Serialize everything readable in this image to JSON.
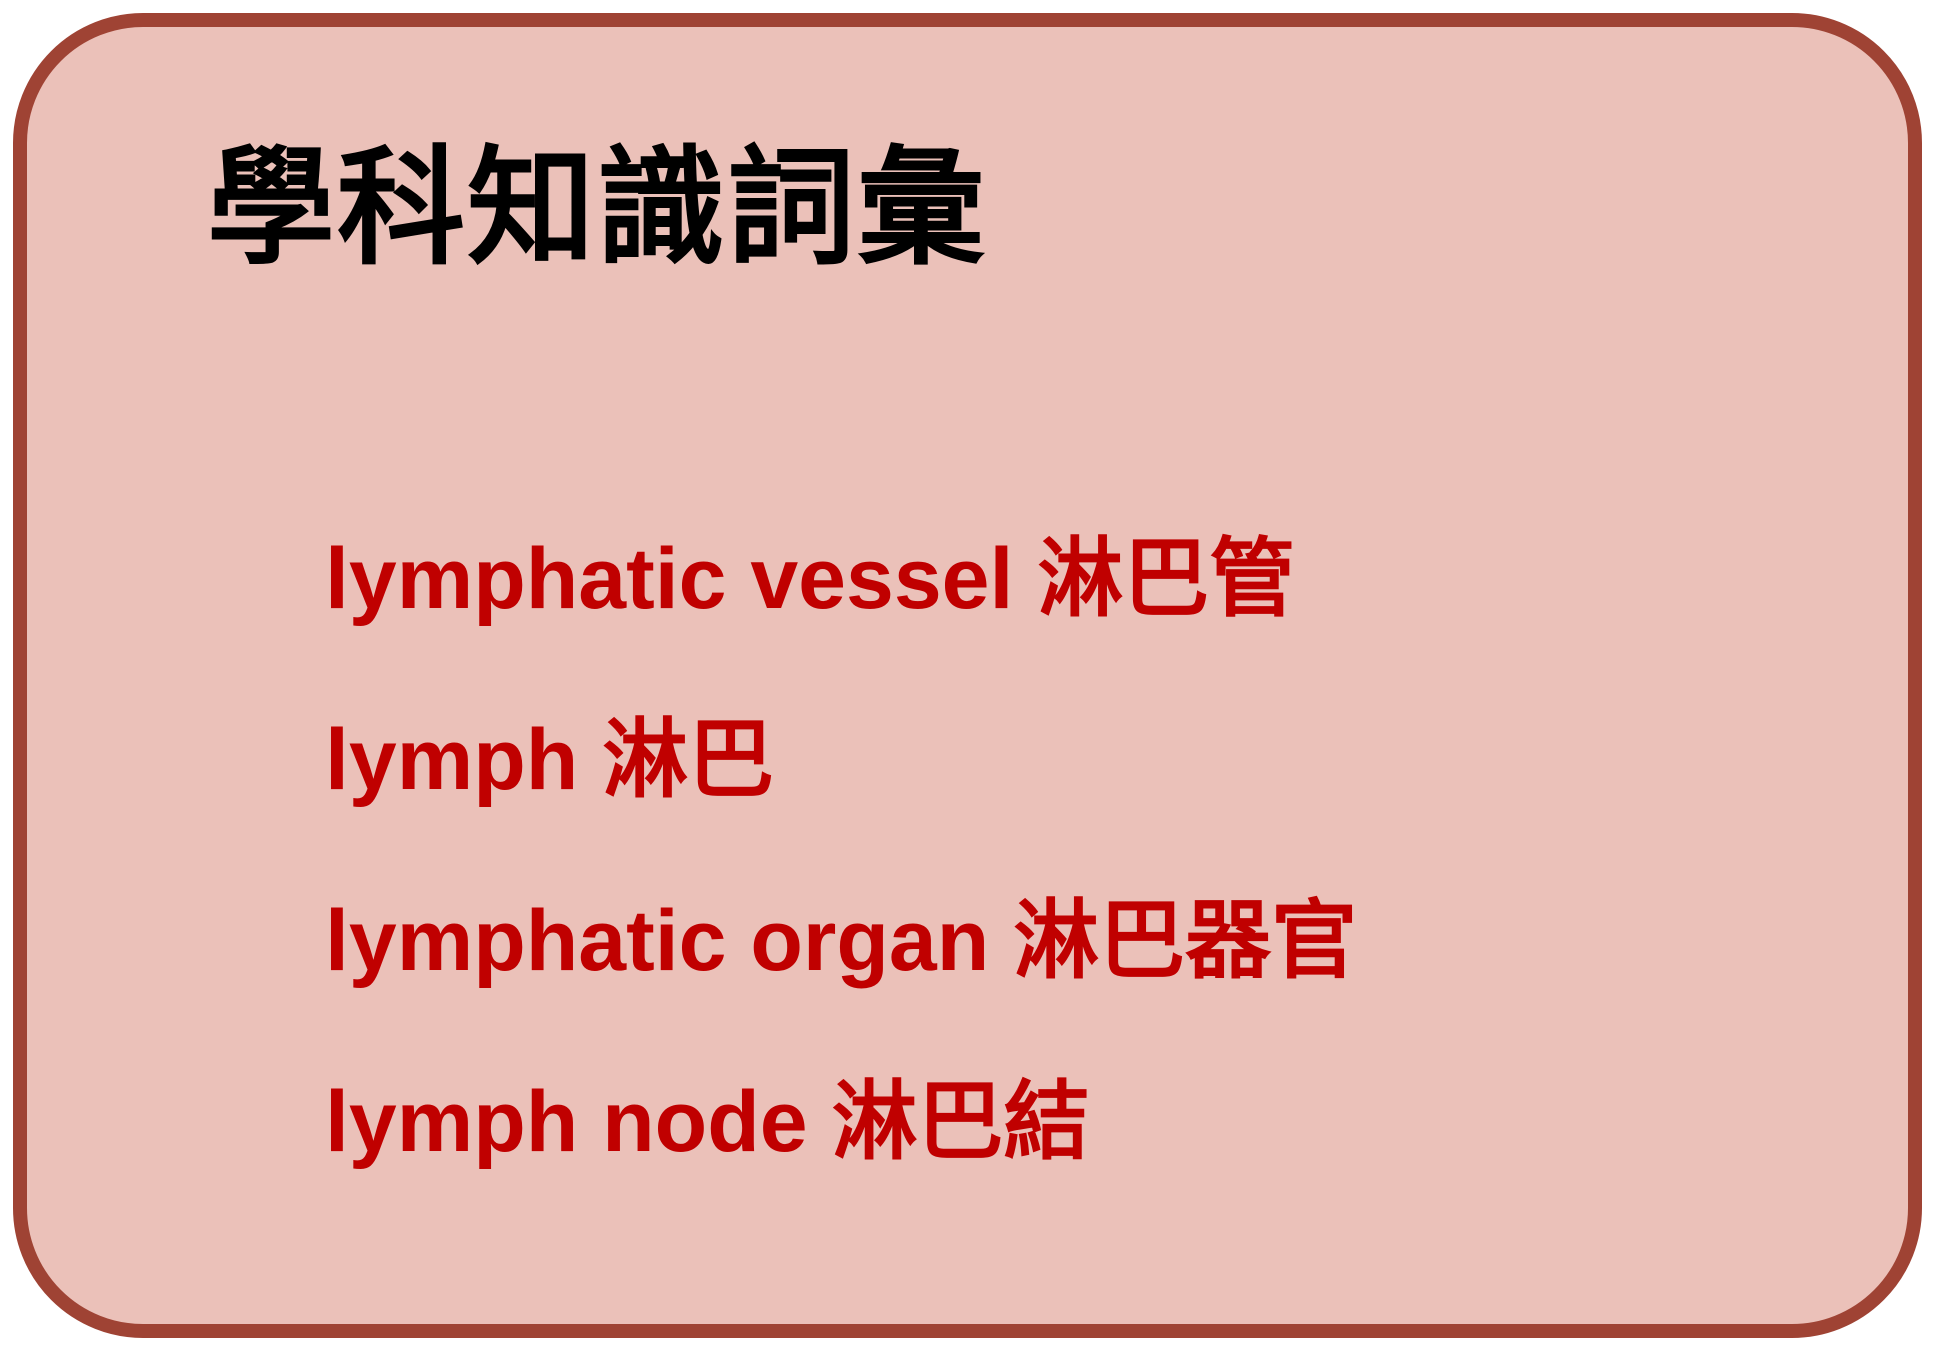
{
  "title": "學科知識詞彙",
  "terms": [
    {
      "text": "lymphatic vessel 淋巴管"
    },
    {
      "text": "lymph 淋巴"
    },
    {
      "text": "lymphatic organ 淋巴器官"
    },
    {
      "text": "lymph node 淋巴結"
    }
  ],
  "colors": {
    "border": "#9f4334",
    "background": "#ebc1b9",
    "title": "#000000",
    "term": "#c00000"
  }
}
